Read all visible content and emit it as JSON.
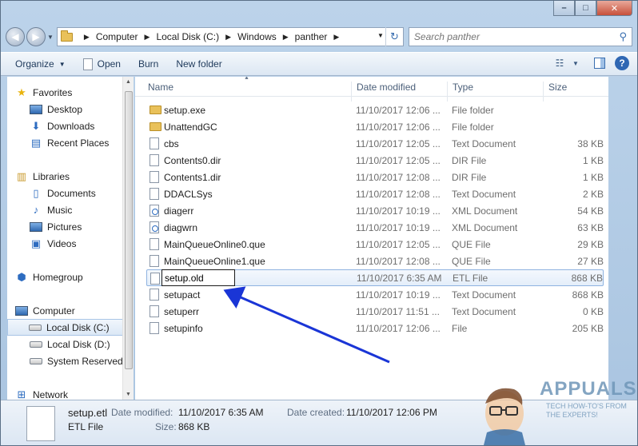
{
  "window": {
    "caption": {
      "minimize": "–",
      "maximize": "□",
      "close": "✕"
    }
  },
  "address": {
    "crumbs": [
      "Computer",
      "Local Disk (C:)",
      "Windows",
      "panther"
    ],
    "search_placeholder": "Search panther"
  },
  "toolbar": {
    "organize": "Organize",
    "open": "Open",
    "burn": "Burn",
    "new_folder": "New folder"
  },
  "nav": {
    "favorites": "Favorites",
    "desktop": "Desktop",
    "downloads": "Downloads",
    "recent_places": "Recent Places",
    "libraries": "Libraries",
    "documents": "Documents",
    "music": "Music",
    "pictures": "Pictures",
    "videos": "Videos",
    "homegroup": "Homegroup",
    "computer": "Computer",
    "local_c": "Local Disk (C:)",
    "local_d": "Local Disk (D:)",
    "system_reserved": "System Reserved",
    "network": "Network"
  },
  "columns": {
    "name": "Name",
    "date": "Date modified",
    "type": "Type",
    "size": "Size"
  },
  "files": [
    {
      "name": "setup.exe",
      "date": "11/10/2017 12:06 ...",
      "type": "File folder",
      "size": "",
      "kind": "folder"
    },
    {
      "name": "UnattendGC",
      "date": "11/10/2017 12:06 ...",
      "type": "File folder",
      "size": "",
      "kind": "folder"
    },
    {
      "name": "cbs",
      "date": "11/10/2017 12:05 ...",
      "type": "Text Document",
      "size": "38 KB",
      "kind": "file"
    },
    {
      "name": "Contents0.dir",
      "date": "11/10/2017 12:05 ...",
      "type": "DIR File",
      "size": "1 KB",
      "kind": "file"
    },
    {
      "name": "Contents1.dir",
      "date": "11/10/2017 12:08 ...",
      "type": "DIR File",
      "size": "1 KB",
      "kind": "file"
    },
    {
      "name": "DDACLSys",
      "date": "11/10/2017 12:08 ...",
      "type": "Text Document",
      "size": "2 KB",
      "kind": "file"
    },
    {
      "name": "diagerr",
      "date": "11/10/2017 10:19 ...",
      "type": "XML Document",
      "size": "54 KB",
      "kind": "xml"
    },
    {
      "name": "diagwrn",
      "date": "11/10/2017 10:19 ...",
      "type": "XML Document",
      "size": "63 KB",
      "kind": "xml"
    },
    {
      "name": "MainQueueOnline0.que",
      "date": "11/10/2017 12:05 ...",
      "type": "QUE File",
      "size": "29 KB",
      "kind": "file"
    },
    {
      "name": "MainQueueOnline1.que",
      "date": "11/10/2017 12:08 ...",
      "type": "QUE File",
      "size": "27 KB",
      "kind": "file"
    },
    {
      "name": "setup.old",
      "date": "11/10/2017 6:35 AM",
      "type": "ETL File",
      "size": "868 KB",
      "kind": "file"
    },
    {
      "name": "setupact",
      "date": "11/10/2017 10:19 ...",
      "type": "Text Document",
      "size": "868 KB",
      "kind": "file"
    },
    {
      "name": "setuperr",
      "date": "11/10/2017 11:51 ...",
      "type": "Text Document",
      "size": "0 KB",
      "kind": "file"
    },
    {
      "name": "setupinfo",
      "date": "11/10/2017 12:06 ...",
      "type": "File",
      "size": "205 KB",
      "kind": "file"
    }
  ],
  "details": {
    "filename": "setup.etl",
    "filetype": "ETL File",
    "date_modified_label": "Date modified:",
    "date_modified": "11/10/2017 6:35 AM",
    "size_label": "Size:",
    "size": "868 KB",
    "date_created_label": "Date created:",
    "date_created": "11/10/2017 12:06 PM"
  },
  "watermark": {
    "brand": "APPUALS",
    "tagline": [
      "TECH HOW-TO'S FROM",
      "THE EXPERTS!"
    ]
  },
  "colors": {
    "accent": "#2f67b3",
    "arrow": "#1a35d6",
    "selection": "#dbe8f6"
  }
}
